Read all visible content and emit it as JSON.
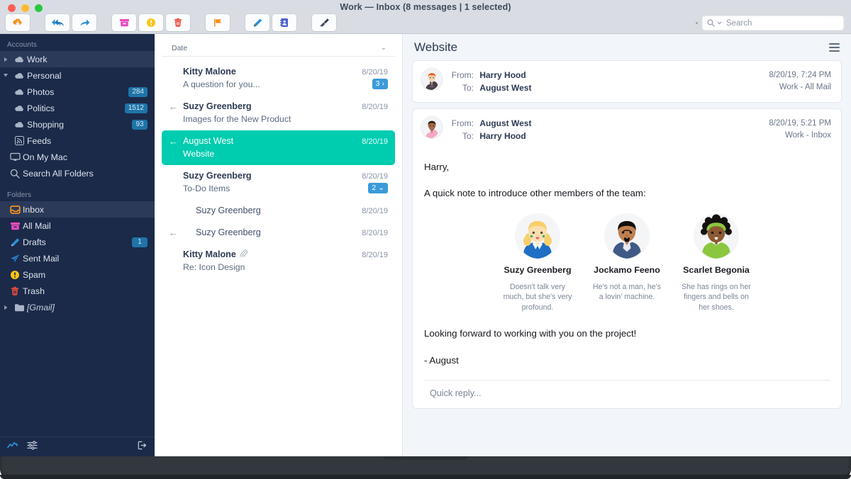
{
  "window": {
    "title": "Work — Inbox (8 messages | 1 selected)",
    "traffic_lights": [
      "close-button",
      "minimize-button",
      "zoom-button"
    ]
  },
  "toolbar": {
    "buttons": [
      {
        "name": "get-mail-button",
        "icon": "cloud-download-icon",
        "color": "#f5901f"
      },
      {
        "name": "reply-all-button",
        "icon": "reply-all-icon",
        "color": "#2d8fd5"
      },
      {
        "name": "forward-button",
        "icon": "forward-arrow-icon",
        "color": "#2d8fd5"
      },
      {
        "name": "archive-button",
        "icon": "archive-box-icon",
        "color": "#e84ac0"
      },
      {
        "name": "junk-button",
        "icon": "warning-circle-icon",
        "color": "#fcc417"
      },
      {
        "name": "delete-button",
        "icon": "trash-icon",
        "color": "#ef4b3a"
      },
      {
        "name": "flag-button",
        "icon": "flag-icon",
        "color": "#f5901f"
      },
      {
        "name": "compose-button",
        "icon": "pencil-icon",
        "color": "#2d8fd5"
      },
      {
        "name": "contacts-button",
        "icon": "address-book-icon",
        "color": "#4a5fd0"
      },
      {
        "name": "cleanup-button",
        "icon": "brush-icon",
        "color": "#2d3b52"
      }
    ]
  },
  "search": {
    "placeholder": "Search",
    "icon": "search-icon"
  },
  "sidebar": {
    "accounts_header": "Accounts",
    "accounts": [
      {
        "label": "Work",
        "icon": "cloud-icon",
        "twisty": "collapsed",
        "selected": true,
        "badge": ""
      },
      {
        "label": "Personal",
        "icon": "cloud-icon",
        "twisty": "expanded",
        "selected": false,
        "badge": ""
      },
      {
        "label": "Photos",
        "icon": "cloud-icon",
        "twisty": "none",
        "selected": false,
        "badge": "284",
        "indent": 1
      },
      {
        "label": "Politics",
        "icon": "cloud-icon",
        "twisty": "none",
        "selected": false,
        "badge": "1512",
        "indent": 1
      },
      {
        "label": "Shopping",
        "icon": "cloud-icon",
        "twisty": "none",
        "selected": false,
        "badge": "93",
        "indent": 1
      },
      {
        "label": "Feeds",
        "icon": "rss-icon",
        "twisty": "none",
        "selected": false,
        "badge": "",
        "indent": 1
      },
      {
        "label": "On My Mac",
        "icon": "monitor-icon",
        "twisty": "none",
        "selected": false,
        "badge": ""
      },
      {
        "label": "Search All Folders",
        "icon": "search-icon",
        "twisty": "none",
        "selected": false,
        "badge": ""
      }
    ],
    "folders_header": "Folders",
    "folders": [
      {
        "label": "Inbox",
        "icon": "inbox-icon",
        "selected": true,
        "badge": ""
      },
      {
        "label": "All Mail",
        "icon": "archive-box-icon",
        "selected": false,
        "badge": ""
      },
      {
        "label": "Drafts",
        "icon": "pencil-icon",
        "selected": false,
        "badge": "1"
      },
      {
        "label": "Sent Mail",
        "icon": "paper-plane-icon",
        "selected": false,
        "badge": ""
      },
      {
        "label": "Spam",
        "icon": "warning-circle-icon",
        "selected": false,
        "badge": ""
      },
      {
        "label": "Trash",
        "icon": "trash-icon",
        "selected": false,
        "badge": ""
      },
      {
        "label": "[Gmail]",
        "icon": "folder-icon",
        "selected": false,
        "badge": "",
        "italic": true,
        "twisty": "collapsed"
      }
    ],
    "footer": {
      "activity_icon": "activity-chart-icon",
      "filter_icon": "sliders-icon",
      "logout_icon": "logout-icon"
    }
  },
  "message_list": {
    "sort_label": "Date",
    "sort_chevron": "chevron-down-icon",
    "messages": [
      {
        "sender": "Kitty Malone",
        "subject": "A question for you...",
        "date": "8/20/19",
        "unread": true,
        "replied": false,
        "thread_badge": "3",
        "thread_badge_chevron": "›",
        "attachment": false,
        "child": false,
        "selected": false
      },
      {
        "sender": "Suzy Greenberg",
        "subject": "Images for the New Product",
        "date": "8/20/19",
        "unread": true,
        "replied": true,
        "thread_badge": "",
        "thread_badge_chevron": "",
        "attachment": false,
        "child": false,
        "selected": false
      },
      {
        "sender": "August West",
        "subject": "Website",
        "date": "8/20/19",
        "unread": false,
        "replied": true,
        "thread_badge": "",
        "thread_badge_chevron": "",
        "attachment": false,
        "child": false,
        "selected": true
      },
      {
        "sender": "Suzy Greenberg",
        "subject": "To-Do Items",
        "date": "8/20/19",
        "unread": true,
        "replied": false,
        "thread_badge": "2",
        "thread_badge_chevron": "⌄",
        "attachment": false,
        "child": false,
        "selected": false
      },
      {
        "sender": "Suzy Greenberg",
        "subject": "",
        "date": "8/20/19",
        "unread": false,
        "replied": false,
        "thread_badge": "",
        "thread_badge_chevron": "",
        "attachment": false,
        "child": true,
        "selected": false
      },
      {
        "sender": "Suzy Greenberg",
        "subject": "",
        "date": "8/20/19",
        "unread": false,
        "replied": true,
        "thread_badge": "",
        "thread_badge_chevron": "",
        "attachment": false,
        "child": true,
        "selected": false
      },
      {
        "sender": "Kitty Malone",
        "subject": "Re: Icon Design",
        "date": "8/20/19",
        "unread": true,
        "replied": false,
        "thread_badge": "",
        "thread_badge_chevron": "",
        "attachment": true,
        "child": false,
        "selected": false
      }
    ]
  },
  "reader": {
    "title": "Website",
    "menu_icon": "hamburger-menu-icon",
    "headers": [
      {
        "avatar": "harry-hood-avatar",
        "from_label": "From:",
        "from_value": "Harry Hood",
        "to_label": "To:",
        "to_value": "August West",
        "timestamp": "8/20/19, 7:24 PM",
        "mailbox": "Work - All Mail"
      },
      {
        "avatar": "august-west-avatar",
        "from_label": "From:",
        "from_value": "August West",
        "to_label": "To:",
        "to_value": "Harry Hood",
        "timestamp": "8/20/19, 5:21 PM",
        "mailbox": "Work - Inbox"
      }
    ],
    "body": {
      "greeting": "Harry,",
      "intro": "A quick note to introduce other members of the team:",
      "team": [
        {
          "name": "Suzy Greenberg",
          "description": "Doesn't talk very much, but she's very profound.",
          "avatar": "suzy-greenberg-avatar"
        },
        {
          "name": "Jockamo Feeno",
          "description": "He's not a man, he's a lovin' machine.",
          "avatar": "jockamo-feeno-avatar"
        },
        {
          "name": "Scarlet Begonia",
          "description": "She has rings on her fingers and bells on her shoes.",
          "avatar": "scarlet-begonia-avatar"
        }
      ],
      "closing": "Looking forward to working with you on the project!",
      "signature": "- August"
    },
    "quick_reply_placeholder": "Quick reply..."
  },
  "colors": {
    "sidebar_bg": "#1b2a49",
    "selection_teal": "#00ccb0",
    "badge_blue": "#1f74a8",
    "thread_badge_blue": "#3b9ad9",
    "titlebar": "#d9dde3"
  }
}
